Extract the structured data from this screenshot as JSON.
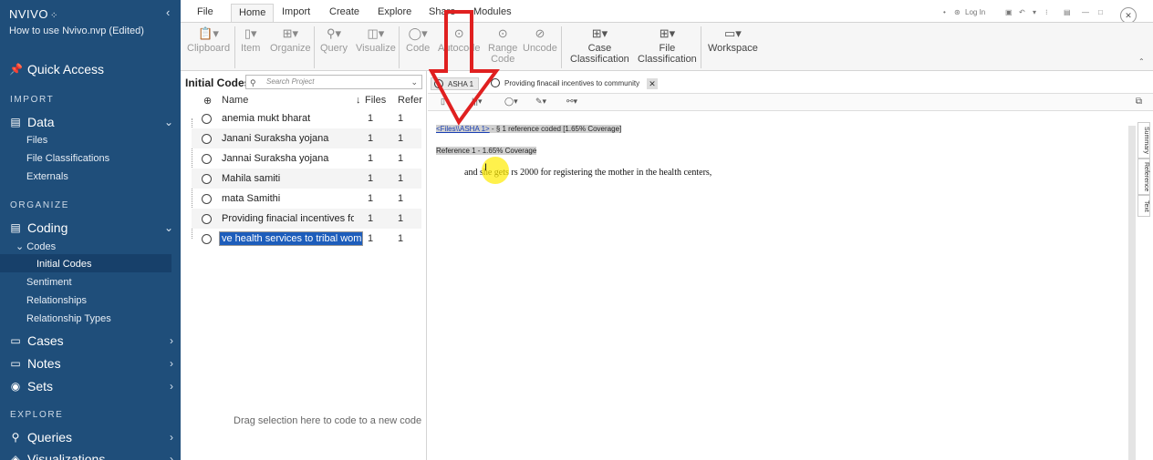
{
  "app": {
    "brand": "NVIVO",
    "project": "How to use Nvivo.nvp (Edited)"
  },
  "sidebar": {
    "quick_access": "Quick Access",
    "import_section": "IMPORT",
    "data": "Data",
    "data_items": [
      "Files",
      "File Classifications",
      "Externals"
    ],
    "organize_section": "ORGANIZE",
    "coding": "Coding",
    "codes": "Codes",
    "initial_codes": "Initial Codes",
    "coding_items": [
      "Sentiment",
      "Relationships",
      "Relationship Types"
    ],
    "cases": "Cases",
    "notes": "Notes",
    "sets": "Sets",
    "explore_section": "EXPLORE",
    "queries": "Queries",
    "visualizations": "Visualizations"
  },
  "ribbon": {
    "tabs": [
      "File",
      "Home",
      "Import",
      "Create",
      "Explore",
      "Share",
      "Modules"
    ],
    "active_tab": "Home",
    "login": "Log In",
    "buttons": {
      "clipboard": "Clipboard",
      "item": "Item",
      "organize": "Organize",
      "query": "Query",
      "visualize": "Visualize",
      "code": "Code",
      "autocode": "Autocode",
      "range_code_1": "Range",
      "range_code_2": "Code",
      "uncode": "Uncode",
      "case_class_1": "Case",
      "case_class_2": "Classification",
      "file_class_1": "File",
      "file_class_2": "Classification",
      "workspace": "Workspace"
    }
  },
  "codes_panel": {
    "title": "Initial Codes",
    "search_placeholder": "Search Project",
    "col_name": "Name",
    "col_files": "Files",
    "col_refs": "Refer",
    "rows": [
      {
        "name": "anemia mukt bharat",
        "files": "1",
        "refs": "1"
      },
      {
        "name": "Janani Suraksha yojana",
        "files": "1",
        "refs": "1"
      },
      {
        "name": "Jannai Suraksha yojana",
        "files": "1",
        "refs": "1"
      },
      {
        "name": "Mahila samiti",
        "files": "1",
        "refs": "1"
      },
      {
        "name": "mata Samithi",
        "files": "1",
        "refs": "1"
      },
      {
        "name": "Providing  finacial incentives fo",
        "files": "1",
        "refs": "1"
      },
      {
        "name": "ve health services to tribal women",
        "files": "1",
        "refs": "1"
      }
    ],
    "drag_hint": "Drag selection here to code to a new code"
  },
  "detail": {
    "tab1": "ASHA 1",
    "tab2": "Providing finacail incentives to community healt",
    "link": "<Files\\\\ASHA 1>",
    "ref_summary": " - § 1 reference coded  [1.65% Coverage]",
    "reference": "Reference 1 - 1.65% Coverage",
    "content": "and she gets rs 2000 for registering the mother in the health centers,",
    "side_tabs": [
      "Summary",
      "Reference",
      "Text"
    ]
  }
}
